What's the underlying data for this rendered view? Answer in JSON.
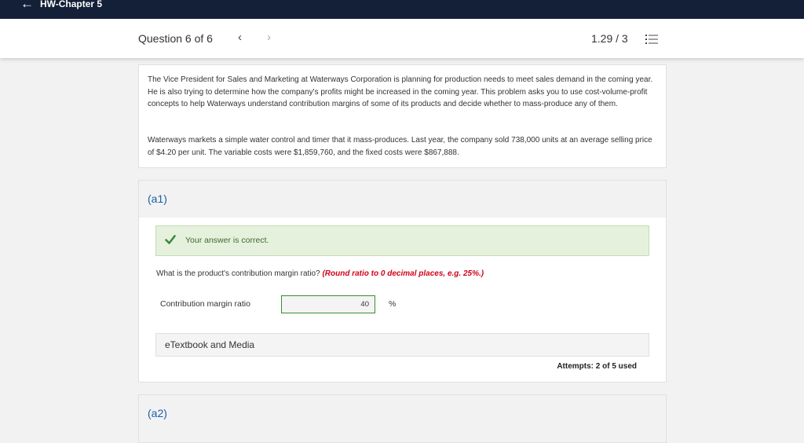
{
  "topbar": {
    "back_icon": "arrow-left-icon",
    "title": "HW-Chapter 5"
  },
  "question_nav": {
    "counter": "Question 6 of 6",
    "prev_label": "‹",
    "next_label": "›",
    "score": "1.29 / 3",
    "list_icon": "list-icon"
  },
  "intro": {
    "paragraph1": "The Vice President for Sales and Marketing at Waterways Corporation is planning for production needs to meet sales demand in the coming year. He is also trying to determine how the company's profits might be increased in the coming year. This problem asks you to use cost-volume-profit concepts to help Waterways understand contribution margins of some of its products and decide whether to mass-produce any of them.",
    "paragraph2": "Waterways markets a simple water control and timer that it mass-produces. Last year, the company sold 738,000 units at an average selling price of $4.20 per unit. The variable costs were $1,859,760, and the fixed costs were $867,888."
  },
  "part_a1": {
    "label": "(a1)",
    "feedback": "Your answer is correct.",
    "feedback_icon": "check-icon",
    "question": "What is the product's contribution margin ratio?",
    "hint": "(Round ratio to 0 decimal places, e.g. 25%.)",
    "field_label": "Contribution margin ratio",
    "field_value": "40",
    "unit": "%",
    "etextbook": "eTextbook and Media",
    "attempts": "Attempts: 2 of 5 used"
  },
  "part_a2": {
    "label": "(a2)"
  },
  "colors": {
    "topbar": "#142038",
    "accent_blue": "#1a5fa8",
    "correct_bg": "#e5f1dd",
    "check_green": "#3d8a3a",
    "hint_red": "#d0021b"
  }
}
